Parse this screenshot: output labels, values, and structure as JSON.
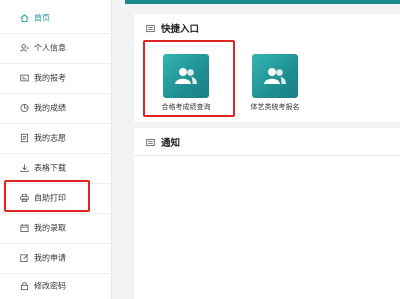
{
  "sidebar": {
    "items": [
      {
        "label": "首页",
        "icon": "home-icon",
        "active": true
      },
      {
        "label": "个人信息",
        "icon": "user-info-icon"
      },
      {
        "label": "我的报考",
        "icon": "id-card-icon"
      },
      {
        "label": "我的成绩",
        "icon": "pie-chart-icon"
      },
      {
        "label": "我的志愿",
        "icon": "document-icon"
      },
      {
        "label": "表格下载",
        "icon": "download-icon"
      },
      {
        "label": "自助打印",
        "icon": "printer-icon"
      },
      {
        "label": "我的录取",
        "icon": "calendar-icon"
      },
      {
        "label": "我的申请",
        "icon": "edit-icon"
      },
      {
        "label": "修改密码",
        "icon": "lock-icon"
      }
    ]
  },
  "quick_entry": {
    "title": "快捷入口",
    "tiles": [
      {
        "label": "合格考成绩查询",
        "icon": "users-icon"
      },
      {
        "label": "体艺类统考报名",
        "icon": "users-icon"
      }
    ]
  },
  "notice": {
    "title": "通知"
  },
  "colors": {
    "accent": "#1a9ea0",
    "tile_gradient_start": "#34b6b2",
    "tile_gradient_end": "#197f86",
    "highlight": "#e02424"
  }
}
